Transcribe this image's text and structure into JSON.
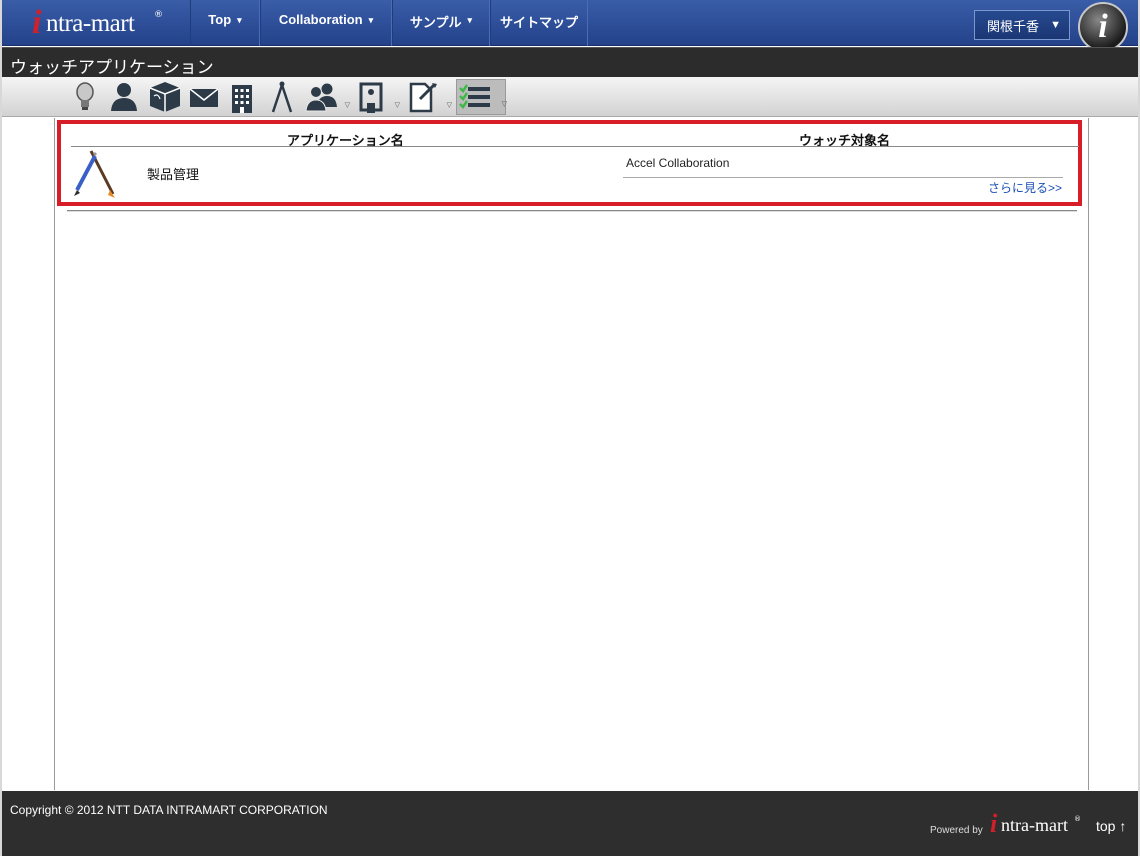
{
  "header": {
    "logo_text": "ntra-mart",
    "logo_initial": "i",
    "logo_registered": "®",
    "nav": [
      {
        "label": "Top",
        "caret": "▾"
      },
      {
        "label": "Collaboration",
        "caret": "▾"
      },
      {
        "label": "サンプル",
        "caret": "▾"
      },
      {
        "label": "サイトマップ",
        "caret": ""
      }
    ],
    "user_name": "関根千香",
    "user_caret": "▼",
    "badge_letter": "i"
  },
  "page_title": "ウォッチアプリケーション",
  "toolbar": {
    "icons": [
      "lightbulb-icon",
      "user-icon",
      "package-icon",
      "mail-icon",
      "building-icon",
      "compass-icon",
      "users-icon",
      "device-icon",
      "document-edit-icon",
      "checklist-icon"
    ],
    "dropdown_mark": "▽"
  },
  "watch_table": {
    "col_app_name": "アプリケーション名",
    "col_watch_target": "ウォッチ対象名",
    "rows": [
      {
        "app_name": "製品管理",
        "icon": "pen-brush-icon",
        "target": "Accel Collaboration",
        "more": "さらに見る>>"
      }
    ]
  },
  "footer": {
    "copyright": "Copyright © 2012 NTT DATA INTRAMART CORPORATION",
    "powered_by": "Powered by",
    "logo_text": "ntra-mart",
    "logo_initial": "i",
    "logo_registered": "®",
    "top_link": "top ↑"
  }
}
